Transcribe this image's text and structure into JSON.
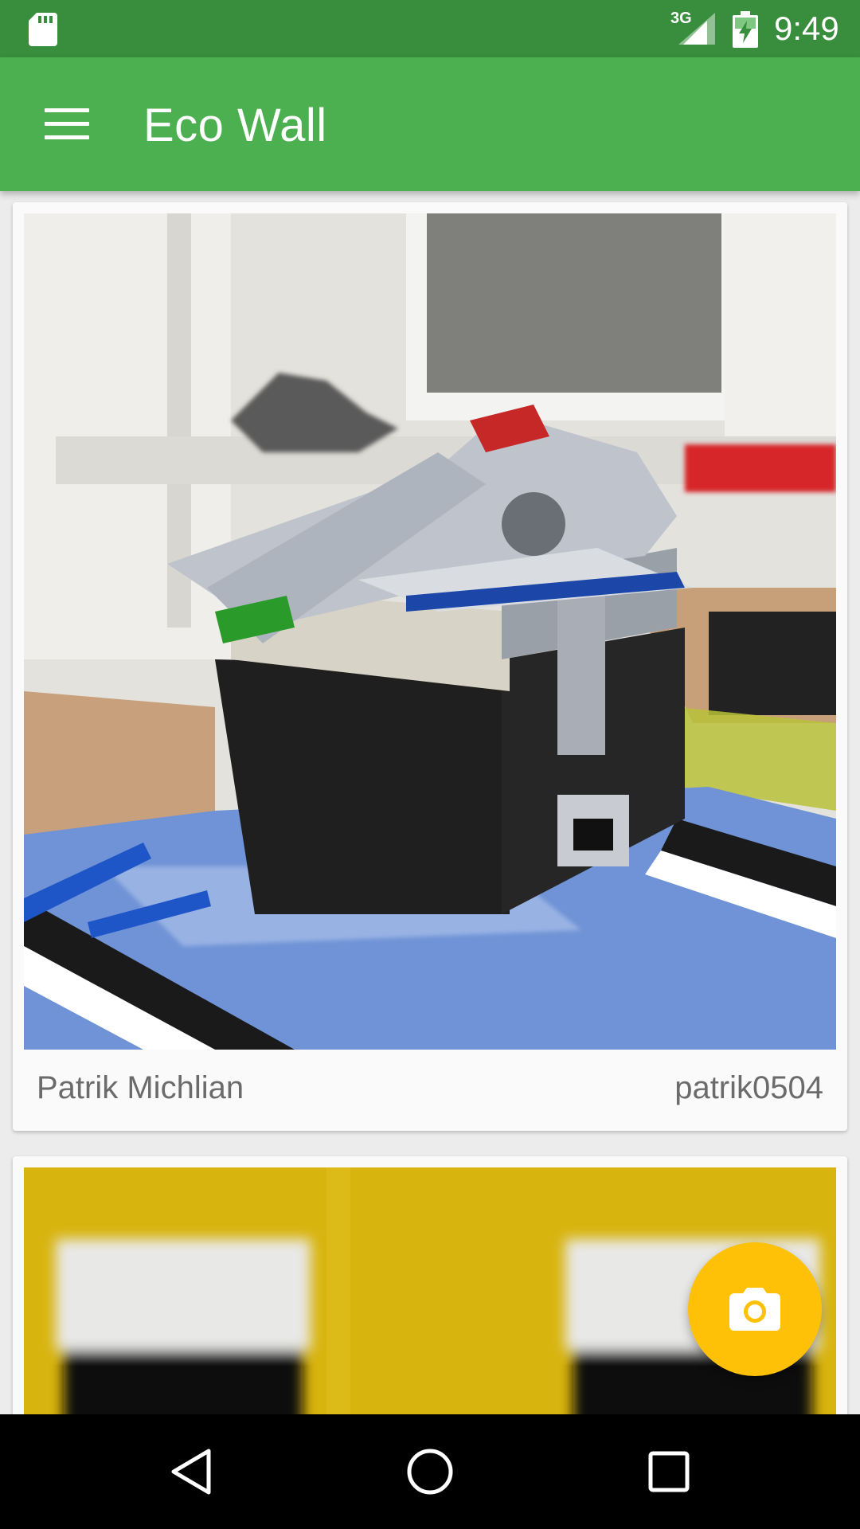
{
  "status_bar": {
    "network": "3G",
    "time": "9:49",
    "icons": [
      "sd-card-icon",
      "signal-icon",
      "battery-charging-icon"
    ]
  },
  "app_bar": {
    "title": "Eco Wall",
    "menu_icon": "hamburger-menu-icon"
  },
  "feed": {
    "posts": [
      {
        "author": "Patrik Michlian",
        "username": "patrik0504"
      }
    ]
  },
  "fab": {
    "icon": "camera-icon",
    "color": "#ffc107"
  },
  "nav_bar": {
    "buttons": [
      "back-icon",
      "home-icon",
      "recents-icon"
    ]
  },
  "colors": {
    "primary": "#4caf50",
    "primary_dark": "#388e3c",
    "accent": "#ffc107"
  }
}
